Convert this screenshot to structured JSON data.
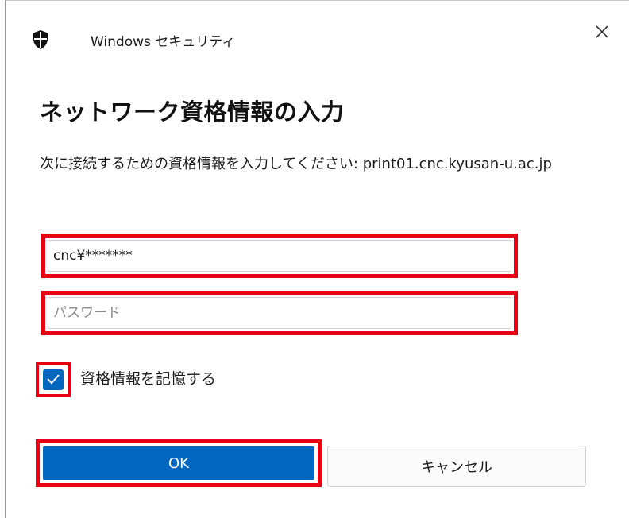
{
  "window": {
    "app_title": "Windows セキュリティ",
    "close_symbol": "×"
  },
  "dialog": {
    "title": "ネットワーク資格情報の入力",
    "message": "次に接続するための資格情報を入力してください: print01.cnc.kyusan-u.ac.jp"
  },
  "form": {
    "username_value": "cnc¥*******",
    "password_placeholder": "パスワード",
    "password_value": "",
    "remember": {
      "checked": true,
      "label": "資格情報を記憶する"
    }
  },
  "buttons": {
    "ok_label": "OK",
    "cancel_label": "キャンセル"
  },
  "colors": {
    "accent": "#0067c0",
    "highlight": "#e60012"
  },
  "icons": {
    "shield": "shield-icon",
    "close": "close-icon",
    "check": "checkmark-icon"
  }
}
